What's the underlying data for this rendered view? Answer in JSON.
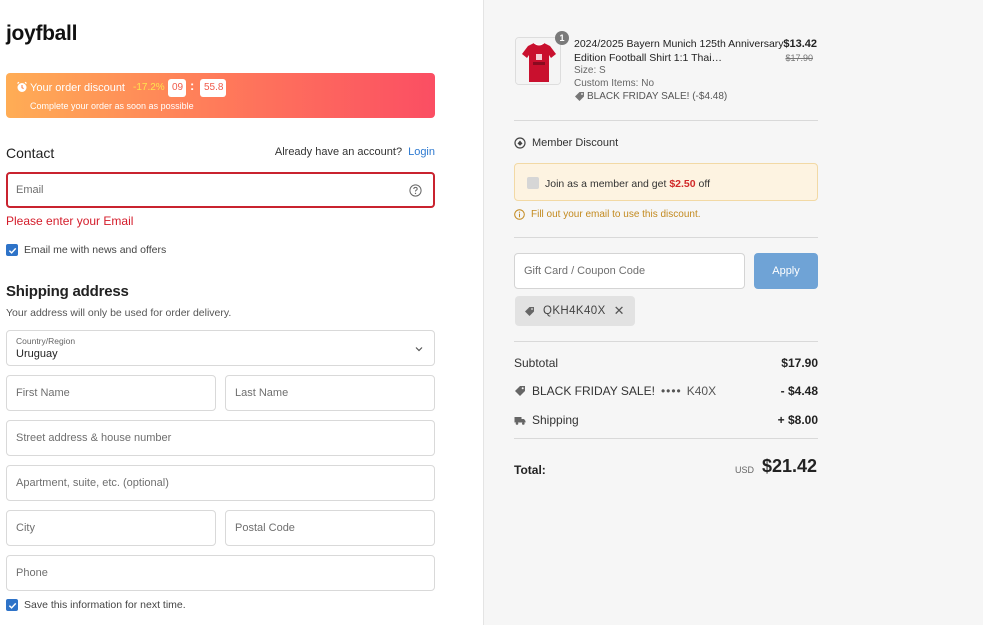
{
  "brand": "joyfball",
  "discount": {
    "title": "Your order discount",
    "percent": "-17.2%",
    "timer_min": "09",
    "timer_sep": ":",
    "timer_sec": "55.8",
    "subtitle": "Complete your order as soon as possible"
  },
  "contact": {
    "heading": "Contact",
    "account_text": "Already have an account?",
    "login_label": "Login",
    "email_placeholder": "Email",
    "email_error": "Please enter your Email",
    "news_label": "Email me with news and offers"
  },
  "shipping": {
    "heading": "Shipping address",
    "subtitle": "Your address will only be used for order delivery.",
    "country_label": "Country/Region",
    "country_value": "Uruguay",
    "first_name": "First Name",
    "last_name": "Last Name",
    "street": "Street address & house number",
    "apartment": "Apartment, suite, etc. (optional)",
    "city": "City",
    "postal": "Postal Code",
    "phone": "Phone",
    "save_label": "Save this information for next time."
  },
  "order": {
    "item": {
      "qty": "1",
      "title": "2024/2025 Bayern Munich 125th Anniversary Edition Football Shirt 1:1 Thai…",
      "size": "Size: S",
      "custom": "Custom Items: No",
      "promo": "BLACK FRIDAY SALE! (-$4.48)",
      "price": "$13.42",
      "price_was": "$17.90"
    },
    "member": {
      "heading": "Member Discount",
      "join_text": "Join as a member and get",
      "join_amount": "$2.50",
      "join_suffix": "off",
      "note": "Fill out your email to use this discount."
    },
    "coupon": {
      "placeholder": "Gift Card / Coupon Code",
      "apply_label": "Apply",
      "applied_code": "QKH4K40X"
    },
    "summary": {
      "subtotal_label": "Subtotal",
      "subtotal_value": "$17.90",
      "discount_label": "BLACK FRIDAY SALE!",
      "discount_dots": "••••",
      "discount_code": "K40X",
      "discount_value": "- $4.48",
      "shipping_label": "Shipping",
      "shipping_value": "+ $8.00",
      "total_label": "Total:",
      "total_currency": "USD",
      "total_value": "$21.42"
    }
  },
  "colors": {
    "accent": "#2e73c8",
    "error": "#d41c2a",
    "apply": "#6fa3d6",
    "discount_gradient_start": "#ffad55",
    "discount_gradient_end": "#fb4e63"
  }
}
